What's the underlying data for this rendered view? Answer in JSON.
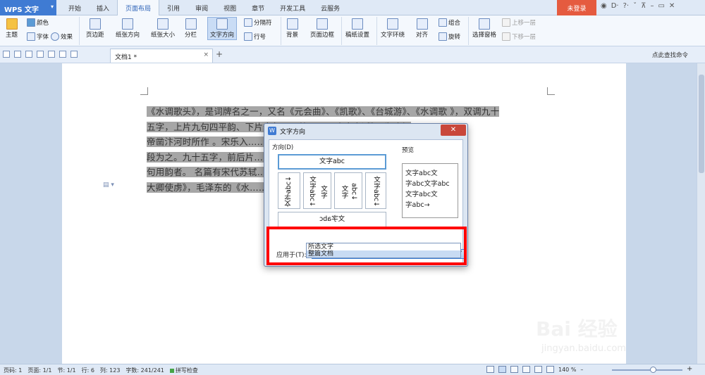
{
  "titlebar": {
    "app_name": "WPS 文字",
    "tabs": [
      "开始",
      "插入",
      "页面布局",
      "引用",
      "审阅",
      "视图",
      "章节",
      "开发工具",
      "云服务"
    ],
    "active_tab": "页面布局",
    "login": "未登录",
    "right_icons": [
      "◉",
      "D·",
      "?·",
      "ˇ",
      "⊼",
      "–",
      "▭",
      "✕"
    ]
  },
  "ribbon": {
    "theme": "主题",
    "color": "颜色",
    "font": "字体",
    "effect": "效果",
    "margins": "页边距",
    "orientation": "纸张方向",
    "size": "纸张大小",
    "columns": "分栏",
    "text_direction": "文字方向",
    "breaks": "分隔符",
    "line_numbers": "行号",
    "background": "背景",
    "page_border": "页面边框",
    "manuscript": "稿纸设置",
    "wrap": "文字环绕",
    "align": "对齐",
    "group": "组合",
    "rotate": "旋转",
    "selection_pane": "选择窗格",
    "bring_forward": "上移一层",
    "send_backward": "下移一层"
  },
  "doc_tab": {
    "name": "文档1 *",
    "close": "×",
    "new": "+",
    "find": "点此查找命令"
  },
  "document": {
    "lines": [
      "《水调歌头》，是词牌名之一，又名《元会曲》、《凯歌》、《台城游》、《水调歌 》，双调九十",
      "五字，上片九句四平韵、下片十句四平韵。……隋唐嘉话》，为隋炀",
      "帝凿汴河时所作 。宋乐入……头”，此殆裁截其首",
      "段为之。九十五字，前后片……有平仄互叶几于句",
      "句用韵者。 名篇有宋代苏轼……水调歌头·送章德茂",
      "大卿使虏》，毛泽东的《水……"
    ]
  },
  "dialog": {
    "title": "文字方向",
    "close": "✕",
    "direction_label": "方向(D)",
    "preview_label": "预览",
    "option_horizontal": "文字abc",
    "option_v1": "文字abc↓",
    "option_v2_col1": "文字",
    "option_v2_col2": "文字abc↓",
    "option_v3_col1": "文字",
    "option_v3_col2": "abc↓",
    "option_v4": "文字abc↓",
    "option_bottom": "文字abc",
    "preview_lines": [
      "文字abc文",
      "字abc文字abc",
      "文字abc文",
      "字abc→"
    ],
    "apply_label": "应用于(T):",
    "apply_value": "所选文字",
    "apply_options": [
      "所选文字",
      "整篇文档"
    ]
  },
  "statusbar": {
    "page_num": "页码: 1",
    "pages": "页面: 1/1",
    "section": "节: 1/1",
    "row": "行: 6",
    "col": "列: 123",
    "words": "字数: 241/241",
    "spell": "拼写检查",
    "zoom": "140 %"
  },
  "watermark": {
    "main": "Bai 经验",
    "sub": "jingyan.baidu.com"
  }
}
